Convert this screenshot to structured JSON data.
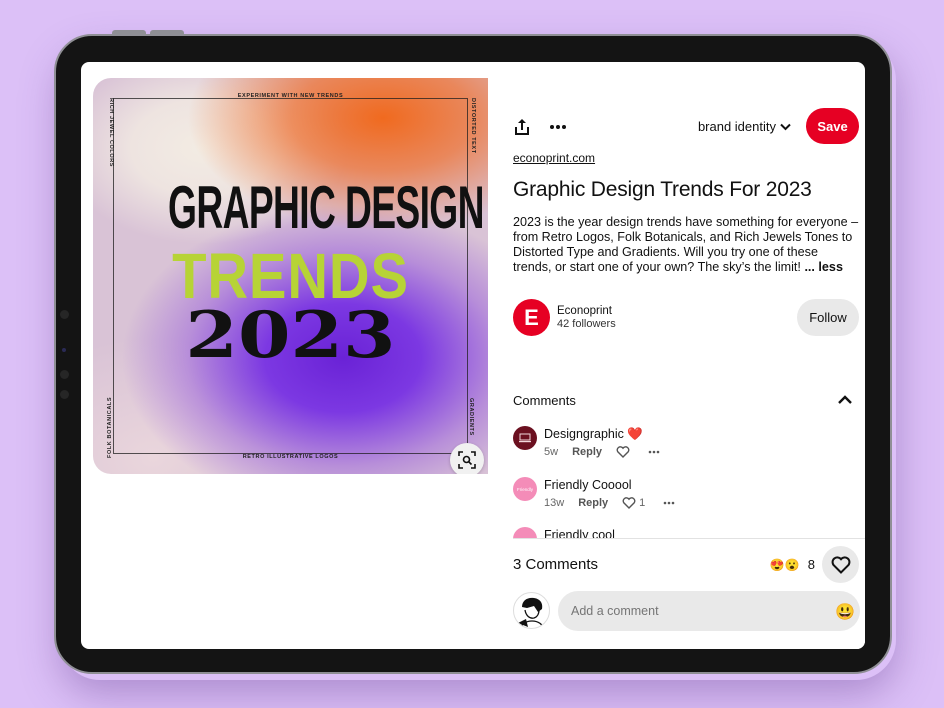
{
  "artwork": {
    "caption_top": "EXPERIMENT WITH NEW TRENDS",
    "caption_bottom": "RETRO ILLUSTRATIVE LOGOS",
    "caption_left": "RICH JEWEL COLORS",
    "caption_right": "DISTORTED TEXT",
    "caption_left_bottom": "FOLK BOTANICALS",
    "caption_right_bottom": "GRADIENTS",
    "line1": "GRAPHIC DESIGN",
    "line2": "TRENDS",
    "line3": "2023",
    "colors": {
      "orange": "#f06a1f",
      "purple": "#6a22d6",
      "lime": "#b7d336"
    }
  },
  "toolbar": {
    "board_label": "brand identity",
    "save_label": "Save",
    "icons": [
      "share-icon",
      "more-options-icon",
      "chevron-down-icon"
    ]
  },
  "pin": {
    "domain": "econoprint.com",
    "title": "Graphic Design Trends For 2023",
    "description": "2023 is the year design trends have something for everyone – from Retro Logos, Folk Botanicals, and Rich Jewels Tones to Distorted Type and Gradients. Will you try one of these trends, or start one of your own? The sky’s the limit!",
    "more_label": "... less"
  },
  "creator": {
    "initial": "E",
    "name": "Econoprint",
    "followers": "42 followers",
    "follow_label": "Follow"
  },
  "comments": {
    "heading": "Comments",
    "items": [
      {
        "user": "Designgraphic",
        "text": "❤️",
        "age": "5w",
        "reply": "Reply",
        "likes": "",
        "avatar_color": "#6b1020"
      },
      {
        "user": "Friendly",
        "text": "Cooool",
        "age": "13w",
        "reply": "Reply",
        "likes": "1",
        "avatar_color": "#f48cb8",
        "avatar_text": "Friendly"
      },
      {
        "user": "Friendly",
        "text": "cool",
        "age": "",
        "reply": "",
        "likes": "",
        "avatar_color": "#f48cb8"
      }
    ],
    "count_label": "3 Comments",
    "reaction_count": "8",
    "reaction_emojis": "😍😮",
    "input_placeholder": "Add a comment",
    "input_emoji": "😃"
  },
  "colors": {
    "brand_red": "#e60023",
    "background": "#dcc0f7"
  }
}
